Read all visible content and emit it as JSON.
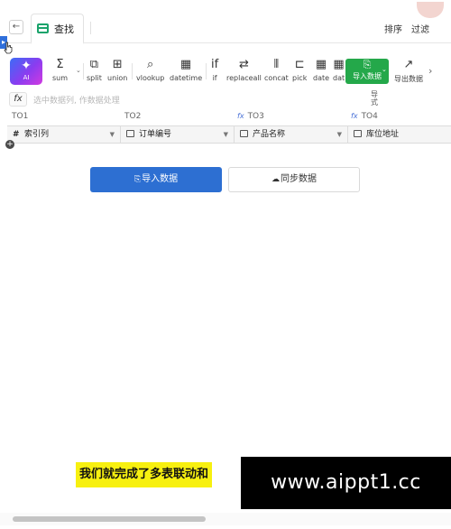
{
  "top": {
    "back_glyph": "←",
    "tab_label": "查找",
    "tab_icon": "table-icon",
    "right_actions": [
      "排序",
      "过滤"
    ]
  },
  "toolbar": {
    "ai_label": "AI",
    "sum_label": "sum",
    "split_label": "split",
    "union_label": "union",
    "vlookup_label": "vlookup",
    "datetime_label": "datetime",
    "if_label": "if",
    "replaceall_label": "replaceall",
    "concat_label": "concat",
    "pick_label": "pick",
    "date_label": "date",
    "date2_label": "dat",
    "import_label": "导入数据",
    "formula_fragment": "导式",
    "export_label": "导出数据",
    "more_glyph": "›"
  },
  "formula_bar": {
    "fx_label": "fx",
    "placeholder": "选中数据列, 作数据处理"
  },
  "columns": {
    "letters": [
      "TO1",
      "TO2",
      "TO3",
      "TO4"
    ],
    "headers": [
      "索引列",
      "订单编号",
      "产品名称",
      "库位地址"
    ]
  },
  "empty_state": {
    "import_button": "导入数据",
    "sync_button": "同步数据"
  },
  "subtitle": "我们就完成了多表联动和",
  "watermark": "www.aippt1.cc",
  "colors": {
    "primary_blue": "#2d6fd2",
    "import_green": "#24a84a",
    "subtitle_yellow": "#f7f010"
  }
}
